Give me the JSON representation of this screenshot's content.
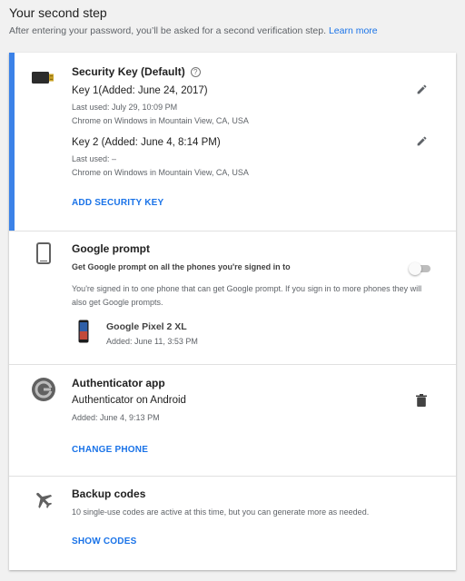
{
  "header": {
    "title": "Your second step",
    "description": "After entering your password, you’ll be asked for a second verification step.",
    "learn_more": "Learn more"
  },
  "security_key": {
    "title": "Security Key (Default)",
    "help_glyph": "?",
    "icon": "usb-key-icon",
    "keys": [
      {
        "name": "Key 1(Added: June 24, 2017)",
        "last_used": "Last used: July 29, 10:09 PM",
        "location": "Chrome on Windows in Mountain View, CA, USA",
        "edit_icon": "pencil-icon"
      },
      {
        "name": "Key 2 (Added: June 4, 8:14 PM)",
        "last_used": "Last used: –",
        "location": "Chrome on Windows in Mountain View, CA, USA",
        "edit_icon": "pencil-icon"
      }
    ],
    "action": "ADD SECURITY KEY",
    "accent_color": "#3b82e8"
  },
  "google_prompt": {
    "title": "Google prompt",
    "icon": "phone-icon",
    "toggle_label": "Get Google prompt on all the phones you're signed in to",
    "toggle_on": false,
    "description": "You're signed in to one phone that can get Google prompt. If you sign in to more phones they will also get Google prompts.",
    "device": {
      "name": "Google Pixel 2 XL",
      "added": "Added: June 11, 3:53 PM",
      "icon": "pixel-phone-icon"
    }
  },
  "authenticator": {
    "title": "Authenticator app",
    "icon": "authenticator-icon",
    "device": "Authenticator on Android",
    "added": "Added: June 4, 9:13 PM",
    "delete_icon": "trash-icon",
    "action": "CHANGE PHONE"
  },
  "backup_codes": {
    "title": "Backup codes",
    "icon": "airplane-icon",
    "description": "10 single-use codes are active at this time, but you can generate more as needed.",
    "action": "SHOW CODES"
  }
}
